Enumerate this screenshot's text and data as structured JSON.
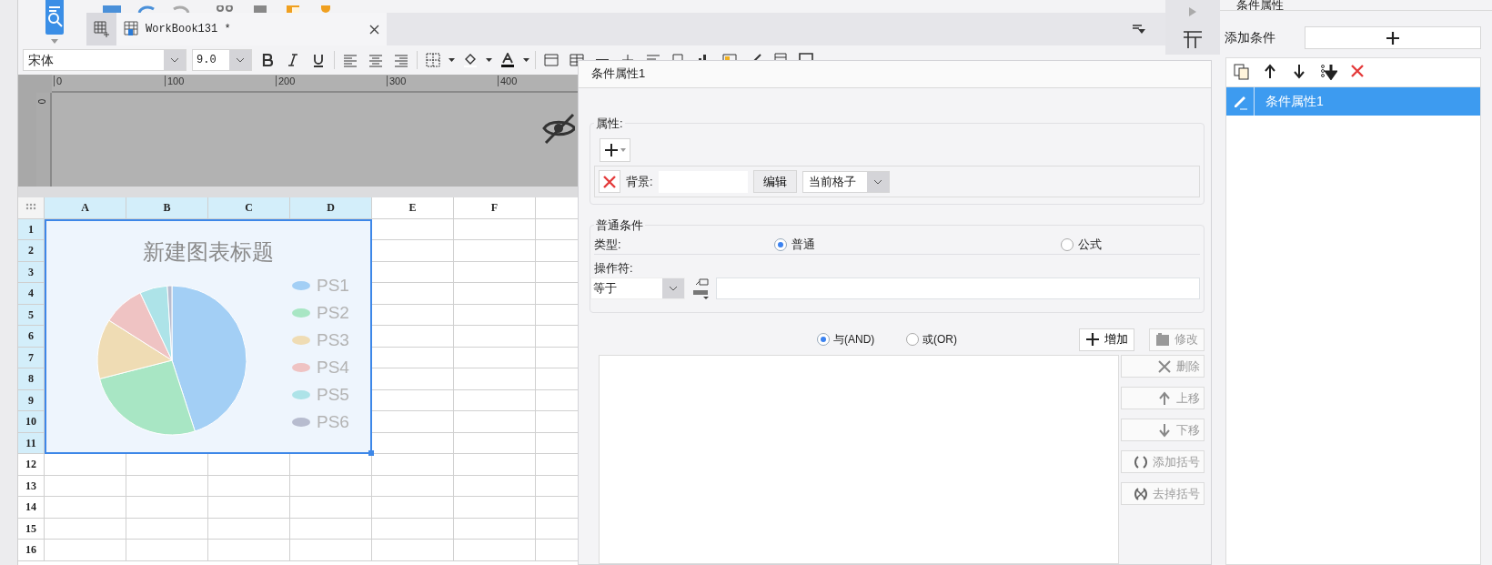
{
  "tabs": [
    {
      "label": "WorkBook131 *",
      "selected": true
    }
  ],
  "format_toolbar": {
    "font": "宋体",
    "font_size": "9.0"
  },
  "ruler": {
    "ticks": [
      "0",
      "100",
      "200",
      "300",
      "400"
    ],
    "vertical_tick": "0"
  },
  "sheet": {
    "columns": [
      {
        "label": "A",
        "selected": true
      },
      {
        "label": "B",
        "selected": true
      },
      {
        "label": "C",
        "selected": true
      },
      {
        "label": "D",
        "selected": true
      },
      {
        "label": "E",
        "selected": false
      },
      {
        "label": "F",
        "selected": false
      }
    ],
    "rows": [
      {
        "label": "1",
        "selected": true
      },
      {
        "label": "2",
        "selected": true
      },
      {
        "label": "3",
        "selected": true
      },
      {
        "label": "4",
        "selected": true
      },
      {
        "label": "5",
        "selected": true
      },
      {
        "label": "6",
        "selected": true
      },
      {
        "label": "7",
        "selected": true
      },
      {
        "label": "8",
        "selected": true
      },
      {
        "label": "9",
        "selected": true
      },
      {
        "label": "10",
        "selected": true
      },
      {
        "label": "11",
        "selected": true
      },
      {
        "label": "12",
        "selected": false
      },
      {
        "label": "13",
        "selected": false
      },
      {
        "label": "14",
        "selected": false
      },
      {
        "label": "15",
        "selected": false
      },
      {
        "label": "16",
        "selected": false
      }
    ]
  },
  "chart": {
    "title": "新建图表标题",
    "legend": [
      {
        "label": "PS1",
        "color": "#a3cff5"
      },
      {
        "label": "PS2",
        "color": "#a8e6c4"
      },
      {
        "label": "PS3",
        "color": "#efdcb4"
      },
      {
        "label": "PS4",
        "color": "#efc3c3"
      },
      {
        "label": "PS5",
        "color": "#ade3e8"
      },
      {
        "label": "PS6",
        "color": "#b7bccf"
      }
    ]
  },
  "dialog": {
    "title": "条件属性1",
    "properties": {
      "legend": "属性:",
      "items": [
        {
          "label": "背景:",
          "edit_button": "编辑",
          "scope": "当前格子"
        }
      ]
    },
    "condition": {
      "legend": "普通条件",
      "type_label": "类型:",
      "type_options": [
        {
          "label": "普通",
          "selected": true
        },
        {
          "label": "公式",
          "selected": false
        }
      ],
      "operator_label": "操作符:",
      "operator": "等于"
    },
    "logic_options": [
      {
        "label": "与(AND)",
        "selected": true
      },
      {
        "label": "或(OR)",
        "selected": false
      }
    ],
    "top_buttons": [
      {
        "kind": "plus",
        "label": "增加",
        "disabled": false
      },
      {
        "kind": "modify",
        "label": "修改",
        "disabled": true
      }
    ],
    "side_buttons": [
      {
        "kind": "delete",
        "label": "删除",
        "disabled": true
      },
      {
        "kind": "up",
        "label": "上移",
        "disabled": true
      },
      {
        "kind": "down",
        "label": "下移",
        "disabled": true
      },
      {
        "kind": "bracket",
        "label": "添加括号",
        "disabled": true
      },
      {
        "kind": "unbracket",
        "label": "去掉括号",
        "disabled": true
      }
    ]
  },
  "right_panel": {
    "title": "条件属性",
    "add_label": "添加条件",
    "items": [
      {
        "label": "条件属性1",
        "selected": true
      }
    ]
  }
}
